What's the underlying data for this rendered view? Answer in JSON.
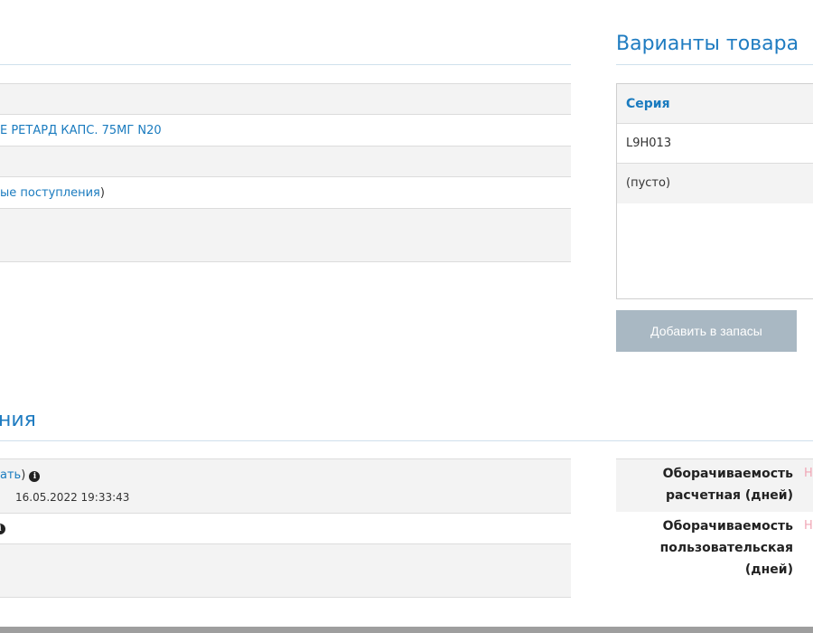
{
  "left_table": {
    "row2": "Е РЕТАРД КАПС. 75МГ N20",
    "row4_link": "ые поступления",
    "row4_paren": ")"
  },
  "variants": {
    "title": "Варианты товара",
    "column_header": "Серия",
    "rows": [
      "L9H013",
      "(пусто)"
    ],
    "add_button": "Добавить в запасы"
  },
  "lower_section": {
    "title": "ния",
    "row1_link": "ать",
    "row1_paren": ")",
    "row1_timestamp": "16.05.2022 19:33:43"
  },
  "stats": [
    {
      "label_line1": "Оборачиваемость",
      "label_line2": "расчетная (дней)",
      "value": "Н"
    },
    {
      "label_line1": "Оборачиваемость",
      "label_line2": "пользовательская",
      "label_line3": "(дней)",
      "value": "Н"
    }
  ],
  "icons": [
    "info-icon"
  ]
}
